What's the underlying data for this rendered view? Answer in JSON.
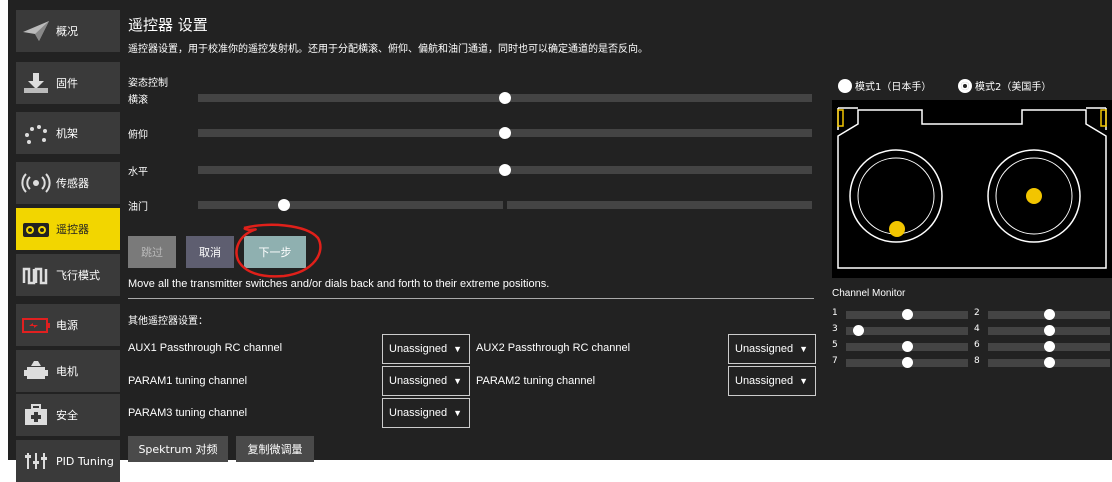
{
  "sidebar": {
    "items": [
      {
        "label": "概况",
        "icon": "paper-plane-icon"
      },
      {
        "label": "固件",
        "icon": "download-icon"
      },
      {
        "label": "机架",
        "icon": "airframe-icon"
      },
      {
        "label": "传感器",
        "icon": "radio-waves-icon"
      },
      {
        "label": "遥控器",
        "icon": "remote-control-icon",
        "active": true
      },
      {
        "label": "飞行模式",
        "icon": "flight-modes-icon"
      },
      {
        "label": "电源",
        "icon": "battery-icon"
      },
      {
        "label": "电机",
        "icon": "motor-icon"
      },
      {
        "label": "安全",
        "icon": "safety-icon"
      },
      {
        "label": "PID Tuning",
        "icon": "pid-tuning-icon"
      }
    ]
  },
  "main": {
    "title": "遥控器 设置",
    "description": "遥控器设置，用于校准你的遥控发射机。还用于分配横滚、俯仰、偏航和油门通道，同时也可以确定通道的是否反向。",
    "attitude_label": "姿态控制",
    "channels": [
      {
        "label": "横滚",
        "value": 0.5
      },
      {
        "label": "俯仰",
        "value": 0.5
      },
      {
        "label": "水平",
        "value": 0.5
      },
      {
        "label": "油门",
        "value": 0.14
      }
    ],
    "buttons": {
      "skip": "跳过",
      "cancel": "取消",
      "next": "下一步"
    },
    "instruction": "Move all the transmitter switches and/or dials back and forth to their extreme positions.",
    "other_settings_label": "其他遥控器设置：",
    "options": {
      "aux1": {
        "label": "AUX1 Passthrough RC channel",
        "value": "Unassigned"
      },
      "aux2": {
        "label": "AUX2 Passthrough RC channel",
        "value": "Unassigned"
      },
      "param1": {
        "label": "PARAM1 tuning channel",
        "value": "Unassigned"
      },
      "param2": {
        "label": "PARAM2 tuning channel",
        "value": "Unassigned"
      },
      "param3": {
        "label": "PARAM3 tuning channel",
        "value": "Unassigned"
      }
    },
    "bottom_buttons": {
      "spektrum": "Spektrum 对频",
      "copy_trims": "复制微调量"
    }
  },
  "right": {
    "mode1": "模式1（日本手）",
    "mode2": "模式2（美国手）",
    "selected_mode": 2,
    "stick_color": "#f2c500",
    "channel_monitor_title": "Channel Monitor",
    "channel_monitor": [
      {
        "num": "1",
        "value": 0.5
      },
      {
        "num": "2",
        "value": 0.5
      },
      {
        "num": "3",
        "value": 0.1
      },
      {
        "num": "4",
        "value": 0.5
      },
      {
        "num": "5",
        "value": 0.5
      },
      {
        "num": "6",
        "value": 0.5
      },
      {
        "num": "7",
        "value": 0.5
      },
      {
        "num": "8",
        "value": 0.5
      }
    ]
  },
  "colors": {
    "accent": "#f2d600",
    "background": "#222222",
    "annotation": "#e0201a"
  }
}
